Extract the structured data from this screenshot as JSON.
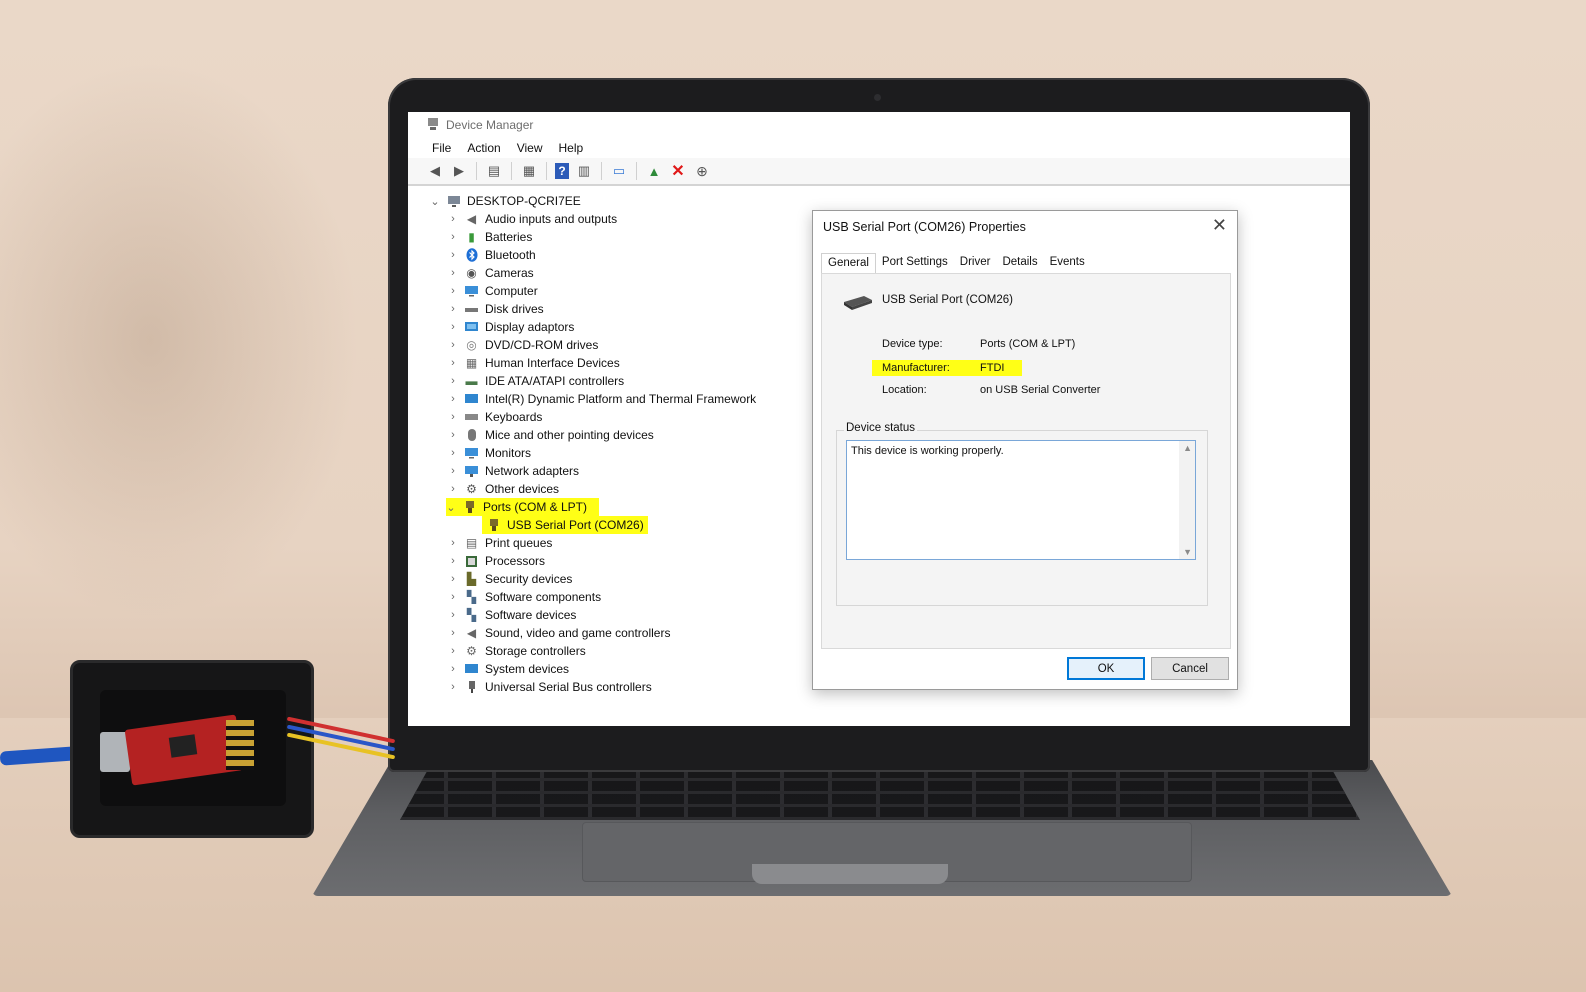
{
  "window": {
    "title": "Device Manager"
  },
  "menu": [
    "File",
    "Action",
    "View",
    "Help"
  ],
  "tree": {
    "root": "DESKTOP-QCRI7EE",
    "items": [
      {
        "label": "Audio inputs and outputs",
        "icon": "speaker-icon",
        "expanded": false
      },
      {
        "label": "Batteries",
        "icon": "battery-icon",
        "expanded": false
      },
      {
        "label": "Bluetooth",
        "icon": "bluetooth-icon",
        "expanded": false
      },
      {
        "label": "Cameras",
        "icon": "camera-icon",
        "expanded": false
      },
      {
        "label": "Computer",
        "icon": "monitor-icon",
        "expanded": false
      },
      {
        "label": "Disk drives",
        "icon": "disk-icon",
        "expanded": false
      },
      {
        "label": "Display adaptors",
        "icon": "display-adapter-icon",
        "expanded": false
      },
      {
        "label": "DVD/CD-ROM drives",
        "icon": "dvd-icon",
        "expanded": false
      },
      {
        "label": "Human Interface Devices",
        "icon": "hid-icon",
        "expanded": false
      },
      {
        "label": "IDE ATA/ATAPI controllers",
        "icon": "ide-icon",
        "expanded": false
      },
      {
        "label": "Intel(R) Dynamic Platform and Thermal Framework",
        "icon": "thermal-icon",
        "expanded": false
      },
      {
        "label": "Keyboards",
        "icon": "keyboard-icon",
        "expanded": false
      },
      {
        "label": "Mice and other pointing devices",
        "icon": "mouse-icon",
        "expanded": false
      },
      {
        "label": "Monitors",
        "icon": "monitor-icon",
        "expanded": false
      },
      {
        "label": "Network adapters",
        "icon": "network-icon",
        "expanded": false
      },
      {
        "label": "Other devices",
        "icon": "unknown-device-icon",
        "expanded": false
      },
      {
        "label": "Ports (COM & LPT)",
        "icon": "port-icon",
        "expanded": true,
        "highlighted": true
      },
      {
        "label": "USB Serial Port (COM26)",
        "icon": "port-icon",
        "child": true,
        "highlighted": true
      },
      {
        "label": "Print queues",
        "icon": "printer-icon",
        "expanded": false
      },
      {
        "label": "Processors",
        "icon": "processor-icon",
        "expanded": false
      },
      {
        "label": "Security devices",
        "icon": "security-icon",
        "expanded": false
      },
      {
        "label": "Software components",
        "icon": "software-component-icon",
        "expanded": false
      },
      {
        "label": "Software devices",
        "icon": "software-device-icon",
        "expanded": false
      },
      {
        "label": "Sound, video and game controllers",
        "icon": "sound-icon",
        "expanded": false
      },
      {
        "label": "Storage controllers",
        "icon": "storage-icon",
        "expanded": false
      },
      {
        "label": "System devices",
        "icon": "system-icon",
        "expanded": false
      },
      {
        "label": "Universal Serial Bus controllers",
        "icon": "usb-icon",
        "expanded": false
      }
    ]
  },
  "dialog": {
    "title": "USB Serial Port (COM26) Properties",
    "tabs": [
      "General",
      "Port Settings",
      "Driver",
      "Details",
      "Events"
    ],
    "active_tab": "General",
    "device_name": "USB Serial Port (COM26)",
    "device_type_label": "Device type:",
    "device_type_value": "Ports (COM & LPT)",
    "manufacturer_label": "Manufacturer:",
    "manufacturer_value": "FTDI",
    "location_label": "Location:",
    "location_value": "on USB Serial Converter",
    "status_group_label": "Device status",
    "status_text": "This device is working properly.",
    "ok_label": "OK",
    "cancel_label": "Cancel"
  },
  "colors": {
    "highlight": "#ffff16",
    "accent": "#0078d7"
  }
}
